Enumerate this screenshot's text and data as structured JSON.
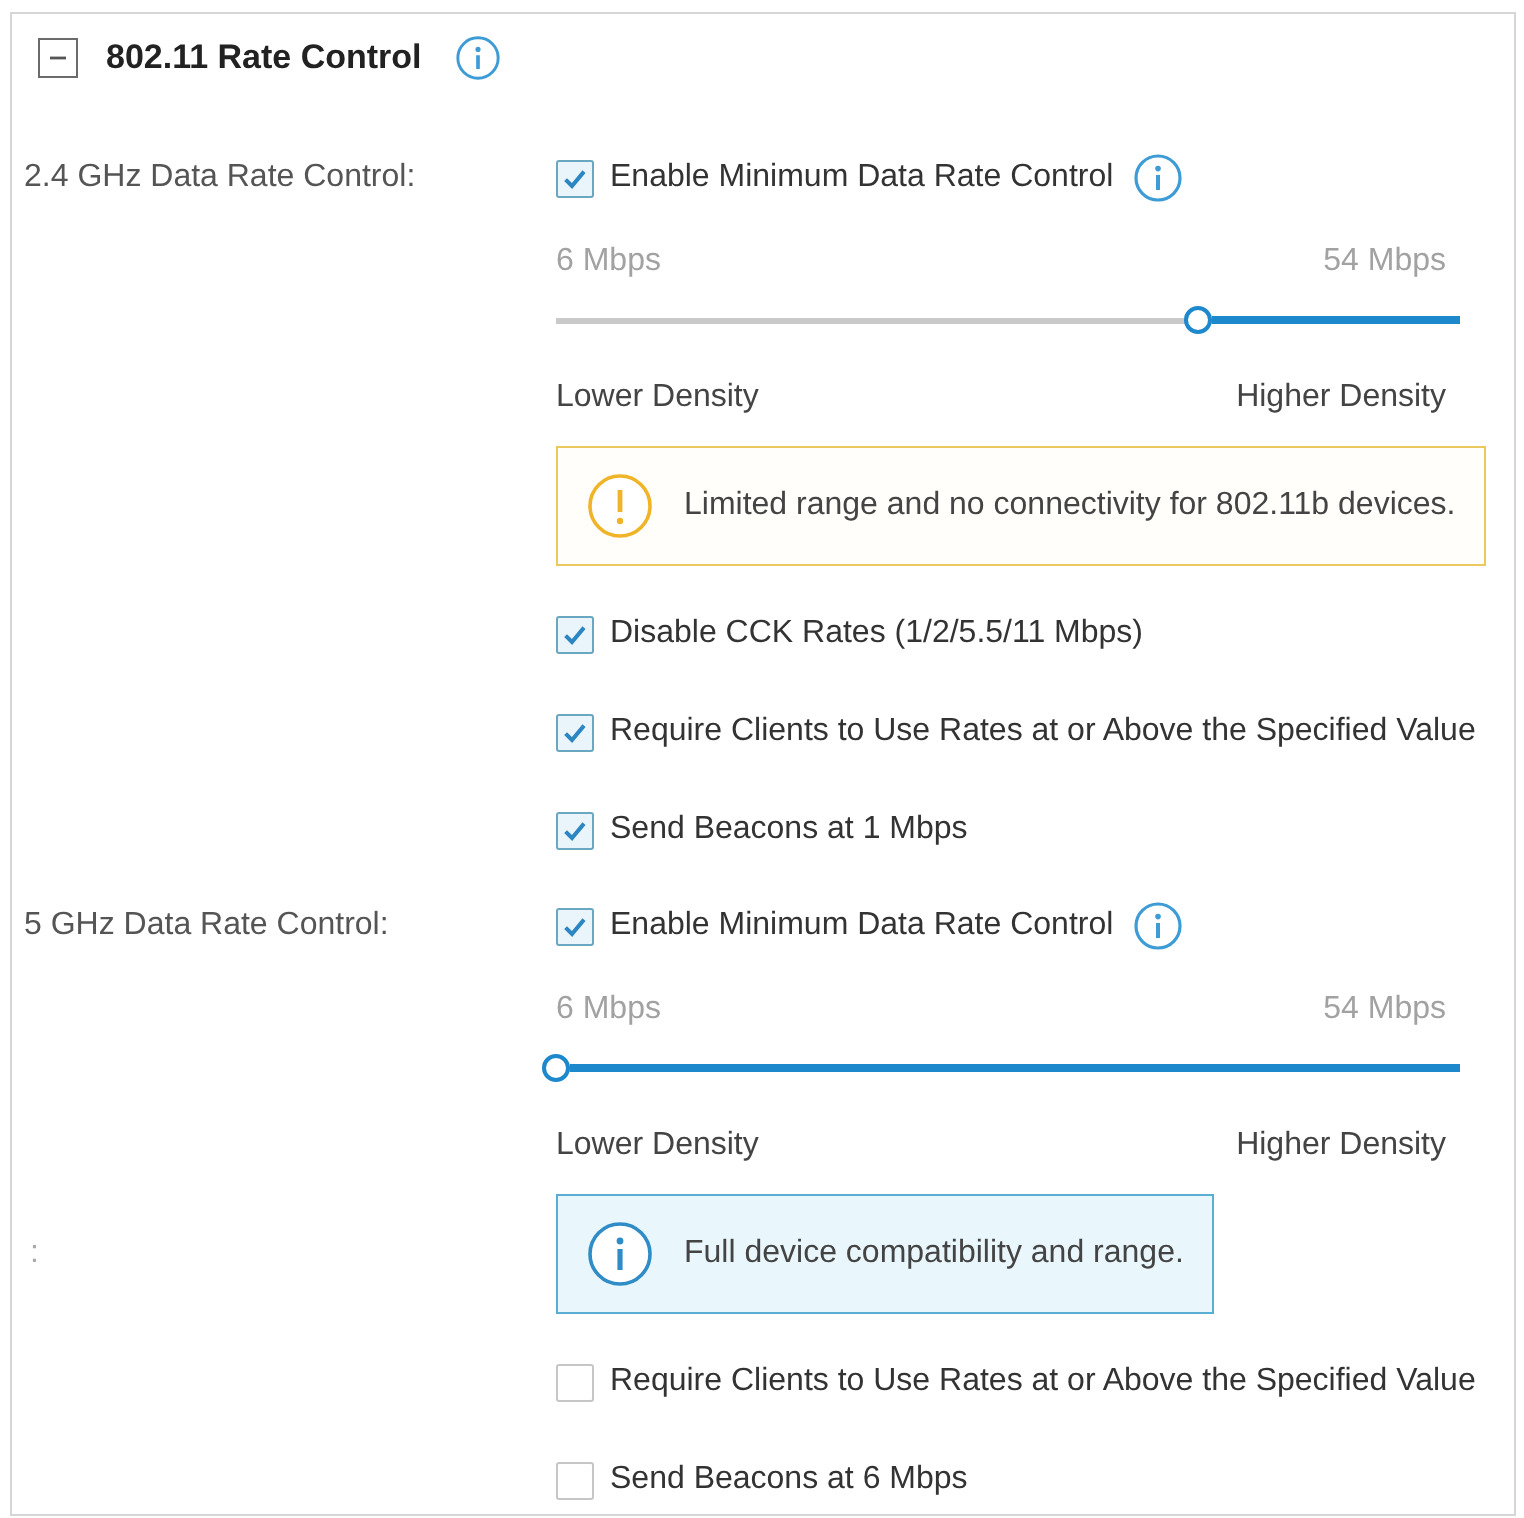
{
  "section": {
    "title": "802.11 Rate Control",
    "expanded": true
  },
  "groups": [
    {
      "label": "2.4 GHz Data Rate Control:",
      "enable": {
        "label": "Enable Minimum Data Rate Control",
        "checked": true
      },
      "slider": {
        "min_label": "6 Mbps",
        "max_label": "54 Mbps",
        "level": 0.71
      },
      "density": {
        "low_label": "Lower Density",
        "high_label": "Higher Density"
      },
      "notice": {
        "kind": "warning",
        "text": "Limited range and no connectivity for 802.11b devices."
      },
      "options": [
        {
          "label": "Disable CCK Rates (1/2/5.5/11 Mbps)",
          "checked": true
        },
        {
          "label": "Require Clients to Use Rates at or Above the Specified Value",
          "checked": true
        },
        {
          "label": "Send Beacons at 1 Mbps",
          "checked": true
        }
      ]
    },
    {
      "label": "5 GHz Data Rate Control:",
      "enable": {
        "label": "Enable Minimum Data Rate Control",
        "checked": true
      },
      "slider": {
        "min_label": "6 Mbps",
        "max_label": "54 Mbps",
        "level": 0
      },
      "density": {
        "low_label": "Lower Density",
        "high_label": "Higher Density"
      },
      "notice": {
        "kind": "info",
        "label": ":",
        "text": "Full device compatibility and range."
      },
      "options": [
        {
          "label": "Require Clients to Use Rates at or Above the Specified Value",
          "checked": false
        },
        {
          "label": "Send Beacons at 6 Mbps",
          "checked": false
        }
      ]
    }
  ]
}
